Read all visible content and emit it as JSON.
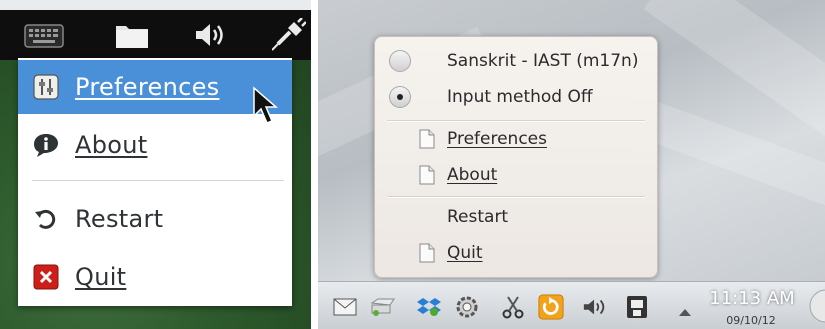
{
  "left_panel": {
    "menu": [
      {
        "label": "Preferences",
        "highlighted": true,
        "icon": "preferences-icon"
      },
      {
        "label": "About",
        "highlighted": false,
        "icon": "info-icon"
      },
      {
        "label": "Restart",
        "highlighted": false,
        "icon": "restart-icon"
      },
      {
        "label": "Quit",
        "highlighted": false,
        "icon": "quit-icon"
      }
    ],
    "highlight_color": "#4a90d9",
    "topbar_icons": [
      "keyboard-icon",
      "folder-icon",
      "volume-icon",
      "plug-icon"
    ]
  },
  "right_panel": {
    "menu": [
      {
        "label": "Sanskrit - IAST (m17n)",
        "type": "radio",
        "checked": false
      },
      {
        "label": "Input method Off",
        "type": "radio",
        "checked": true
      },
      {
        "label": "Preferences",
        "type": "doc"
      },
      {
        "label": "About",
        "type": "doc"
      },
      {
        "label": "Restart",
        "type": "plain"
      },
      {
        "label": "Quit",
        "type": "doc"
      }
    ],
    "clock": {
      "time": "11:13 AM",
      "date": "09/10/12"
    },
    "tray_icons": [
      "mail-icon",
      "storage-icon",
      "dropbox-icon",
      "settings-gear-icon",
      "scissors-icon",
      "update-icon",
      "volume-icon",
      "network-icon"
    ]
  }
}
